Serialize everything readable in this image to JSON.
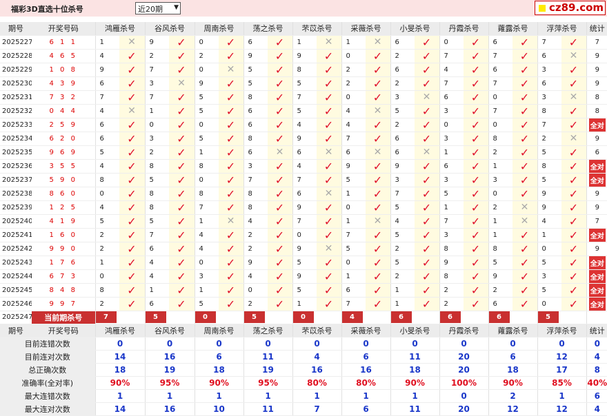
{
  "header": {
    "title": "福彩3D直选十位杀号",
    "period_select": "近20期",
    "logo": "cz89.com"
  },
  "columns": [
    "期号",
    "开奖号码",
    "鸿雁杀号",
    "谷风杀号",
    "周南杀号",
    "荡之杀号",
    "芣苡杀号",
    "采薇杀号",
    "小旻杀号",
    "丹霞杀号",
    "蕹露杀号",
    "浮萍杀号",
    "统计"
  ],
  "rows": [
    {
      "period": "2025227",
      "draw": "611",
      "kills": [
        [
          1,
          0
        ],
        [
          9,
          1
        ],
        [
          0,
          1
        ],
        [
          6,
          1
        ],
        [
          1,
          0
        ],
        [
          1,
          0
        ],
        [
          6,
          1
        ],
        [
          0,
          1
        ],
        [
          6,
          1
        ],
        [
          7,
          1
        ]
      ],
      "stat": "7"
    },
    {
      "period": "2025228",
      "draw": "465",
      "kills": [
        [
          4,
          1
        ],
        [
          2,
          1
        ],
        [
          2,
          1
        ],
        [
          9,
          1
        ],
        [
          9,
          1
        ],
        [
          0,
          1
        ],
        [
          2,
          1
        ],
        [
          7,
          1
        ],
        [
          7,
          1
        ],
        [
          6,
          0
        ]
      ],
      "stat": "9"
    },
    {
      "period": "2025229",
      "draw": "108",
      "kills": [
        [
          9,
          1
        ],
        [
          7,
          1
        ],
        [
          0,
          0
        ],
        [
          5,
          1
        ],
        [
          8,
          1
        ],
        [
          2,
          1
        ],
        [
          6,
          1
        ],
        [
          4,
          1
        ],
        [
          6,
          1
        ],
        [
          3,
          1
        ]
      ],
      "stat": "9"
    },
    {
      "period": "2025230",
      "draw": "439",
      "kills": [
        [
          6,
          1
        ],
        [
          3,
          0
        ],
        [
          9,
          1
        ],
        [
          5,
          1
        ],
        [
          5,
          1
        ],
        [
          2,
          1
        ],
        [
          2,
          1
        ],
        [
          7,
          1
        ],
        [
          7,
          1
        ],
        [
          6,
          1
        ]
      ],
      "stat": "9"
    },
    {
      "period": "2025231",
      "draw": "732",
      "kills": [
        [
          7,
          1
        ],
        [
          7,
          1
        ],
        [
          5,
          1
        ],
        [
          8,
          1
        ],
        [
          7,
          1
        ],
        [
          0,
          1
        ],
        [
          3,
          0
        ],
        [
          6,
          1
        ],
        [
          0,
          1
        ],
        [
          3,
          0
        ]
      ],
      "stat": "8"
    },
    {
      "period": "2025232",
      "draw": "044",
      "kills": [
        [
          4,
          0
        ],
        [
          1,
          1
        ],
        [
          5,
          1
        ],
        [
          6,
          1
        ],
        [
          5,
          1
        ],
        [
          4,
          0
        ],
        [
          5,
          1
        ],
        [
          3,
          1
        ],
        [
          7,
          1
        ],
        [
          8,
          1
        ]
      ],
      "stat": "8"
    },
    {
      "period": "2025233",
      "draw": "259",
      "kills": [
        [
          6,
          1
        ],
        [
          0,
          1
        ],
        [
          0,
          1
        ],
        [
          6,
          1
        ],
        [
          4,
          1
        ],
        [
          4,
          1
        ],
        [
          2,
          1
        ],
        [
          0,
          1
        ],
        [
          0,
          1
        ],
        [
          7,
          1
        ]
      ],
      "stat": "全对"
    },
    {
      "period": "2025234",
      "draw": "620",
      "kills": [
        [
          6,
          1
        ],
        [
          3,
          1
        ],
        [
          5,
          1
        ],
        [
          8,
          1
        ],
        [
          9,
          1
        ],
        [
          7,
          1
        ],
        [
          6,
          1
        ],
        [
          3,
          1
        ],
        [
          8,
          1
        ],
        [
          2,
          0
        ]
      ],
      "stat": "9"
    },
    {
      "period": "2025235",
      "draw": "969",
      "kills": [
        [
          5,
          1
        ],
        [
          2,
          1
        ],
        [
          1,
          1
        ],
        [
          6,
          0
        ],
        [
          6,
          0
        ],
        [
          6,
          0
        ],
        [
          6,
          0
        ],
        [
          1,
          1
        ],
        [
          2,
          1
        ],
        [
          5,
          1
        ]
      ],
      "stat": "6"
    },
    {
      "period": "2025236",
      "draw": "355",
      "kills": [
        [
          4,
          1
        ],
        [
          8,
          1
        ],
        [
          8,
          1
        ],
        [
          3,
          1
        ],
        [
          4,
          1
        ],
        [
          9,
          1
        ],
        [
          9,
          1
        ],
        [
          6,
          1
        ],
        [
          1,
          1
        ],
        [
          8,
          1
        ]
      ],
      "stat": "全对"
    },
    {
      "period": "2025237",
      "draw": "590",
      "kills": [
        [
          8,
          1
        ],
        [
          5,
          1
        ],
        [
          0,
          1
        ],
        [
          7,
          1
        ],
        [
          7,
          1
        ],
        [
          5,
          1
        ],
        [
          3,
          1
        ],
        [
          3,
          1
        ],
        [
          3,
          1
        ],
        [
          5,
          1
        ]
      ],
      "stat": "全对"
    },
    {
      "period": "2025238",
      "draw": "860",
      "kills": [
        [
          0,
          1
        ],
        [
          8,
          1
        ],
        [
          8,
          1
        ],
        [
          8,
          1
        ],
        [
          6,
          0
        ],
        [
          1,
          1
        ],
        [
          7,
          1
        ],
        [
          5,
          1
        ],
        [
          0,
          1
        ],
        [
          9,
          1
        ]
      ],
      "stat": "9"
    },
    {
      "period": "2025239",
      "draw": "125",
      "kills": [
        [
          4,
          1
        ],
        [
          8,
          1
        ],
        [
          7,
          1
        ],
        [
          8,
          1
        ],
        [
          9,
          1
        ],
        [
          0,
          1
        ],
        [
          5,
          1
        ],
        [
          1,
          1
        ],
        [
          2,
          0
        ],
        [
          9,
          1
        ]
      ],
      "stat": "9"
    },
    {
      "period": "2025240",
      "draw": "419",
      "kills": [
        [
          5,
          1
        ],
        [
          5,
          1
        ],
        [
          1,
          0
        ],
        [
          4,
          1
        ],
        [
          7,
          1
        ],
        [
          1,
          0
        ],
        [
          4,
          1
        ],
        [
          7,
          1
        ],
        [
          1,
          0
        ],
        [
          4,
          1
        ]
      ],
      "stat": "7"
    },
    {
      "period": "2025241",
      "draw": "160",
      "kills": [
        [
          2,
          1
        ],
        [
          7,
          1
        ],
        [
          4,
          1
        ],
        [
          2,
          1
        ],
        [
          0,
          1
        ],
        [
          7,
          1
        ],
        [
          5,
          1
        ],
        [
          3,
          1
        ],
        [
          1,
          1
        ],
        [
          1,
          1
        ]
      ],
      "stat": "全对"
    },
    {
      "period": "2025242",
      "draw": "990",
      "kills": [
        [
          2,
          1
        ],
        [
          6,
          1
        ],
        [
          4,
          1
        ],
        [
          2,
          1
        ],
        [
          9,
          0
        ],
        [
          5,
          1
        ],
        [
          2,
          1
        ],
        [
          8,
          1
        ],
        [
          8,
          1
        ],
        [
          0,
          1
        ]
      ],
      "stat": "9"
    },
    {
      "period": "2025243",
      "draw": "176",
      "kills": [
        [
          1,
          1
        ],
        [
          4,
          1
        ],
        [
          0,
          1
        ],
        [
          9,
          1
        ],
        [
          5,
          1
        ],
        [
          0,
          1
        ],
        [
          5,
          1
        ],
        [
          9,
          1
        ],
        [
          5,
          1
        ],
        [
          5,
          1
        ]
      ],
      "stat": "全对"
    },
    {
      "period": "2025244",
      "draw": "673",
      "kills": [
        [
          0,
          1
        ],
        [
          4,
          1
        ],
        [
          3,
          1
        ],
        [
          4,
          1
        ],
        [
          9,
          1
        ],
        [
          1,
          1
        ],
        [
          2,
          1
        ],
        [
          8,
          1
        ],
        [
          9,
          1
        ],
        [
          3,
          1
        ]
      ],
      "stat": "全对"
    },
    {
      "period": "2025245",
      "draw": "848",
      "kills": [
        [
          8,
          1
        ],
        [
          1,
          1
        ],
        [
          1,
          1
        ],
        [
          0,
          1
        ],
        [
          5,
          1
        ],
        [
          6,
          1
        ],
        [
          1,
          1
        ],
        [
          2,
          1
        ],
        [
          2,
          1
        ],
        [
          5,
          1
        ]
      ],
      "stat": "全对"
    },
    {
      "period": "2025246",
      "draw": "997",
      "kills": [
        [
          2,
          1
        ],
        [
          6,
          1
        ],
        [
          5,
          1
        ],
        [
          2,
          1
        ],
        [
          1,
          1
        ],
        [
          7,
          1
        ],
        [
          1,
          1
        ],
        [
          2,
          1
        ],
        [
          6,
          1
        ],
        [
          0,
          1
        ]
      ],
      "stat": "全对"
    }
  ],
  "current": {
    "period": "2025247",
    "label": "当前期杀号",
    "kills": [
      "7",
      "5",
      "0",
      "5",
      "0",
      "4",
      "6",
      "6",
      "6",
      "5"
    ]
  },
  "summary": [
    {
      "label": "目前连错次数",
      "values": [
        "0",
        "0",
        "0",
        "0",
        "0",
        "0",
        "0",
        "0",
        "0",
        "0"
      ],
      "stat": "0"
    },
    {
      "label": "目前连对次数",
      "values": [
        "14",
        "16",
        "6",
        "11",
        "4",
        "6",
        "11",
        "20",
        "6",
        "12"
      ],
      "stat": "4"
    },
    {
      "label": "总正确次数",
      "values": [
        "18",
        "19",
        "18",
        "19",
        "16",
        "16",
        "18",
        "20",
        "18",
        "17"
      ],
      "stat": "8"
    },
    {
      "label": "准确率(全对率)",
      "values": [
        "90%",
        "95%",
        "90%",
        "95%",
        "80%",
        "80%",
        "90%",
        "100%",
        "90%",
        "85%"
      ],
      "stat": "40%"
    },
    {
      "label": "最大连错次数",
      "values": [
        "1",
        "1",
        "1",
        "1",
        "1",
        "1",
        "1",
        "0",
        "2",
        "1"
      ],
      "stat": "6"
    },
    {
      "label": "最大连对次数",
      "values": [
        "14",
        "16",
        "10",
        "11",
        "7",
        "6",
        "11",
        "20",
        "12",
        "12"
      ],
      "stat": "4"
    }
  ],
  "icons": {
    "correct": "check-icon",
    "wrong": "cross-icon"
  },
  "colors": {
    "correct": "#e0102a",
    "wrong": "#aaaaaa",
    "highlight": "#c93030",
    "summary_blue": "#1a37c9"
  }
}
